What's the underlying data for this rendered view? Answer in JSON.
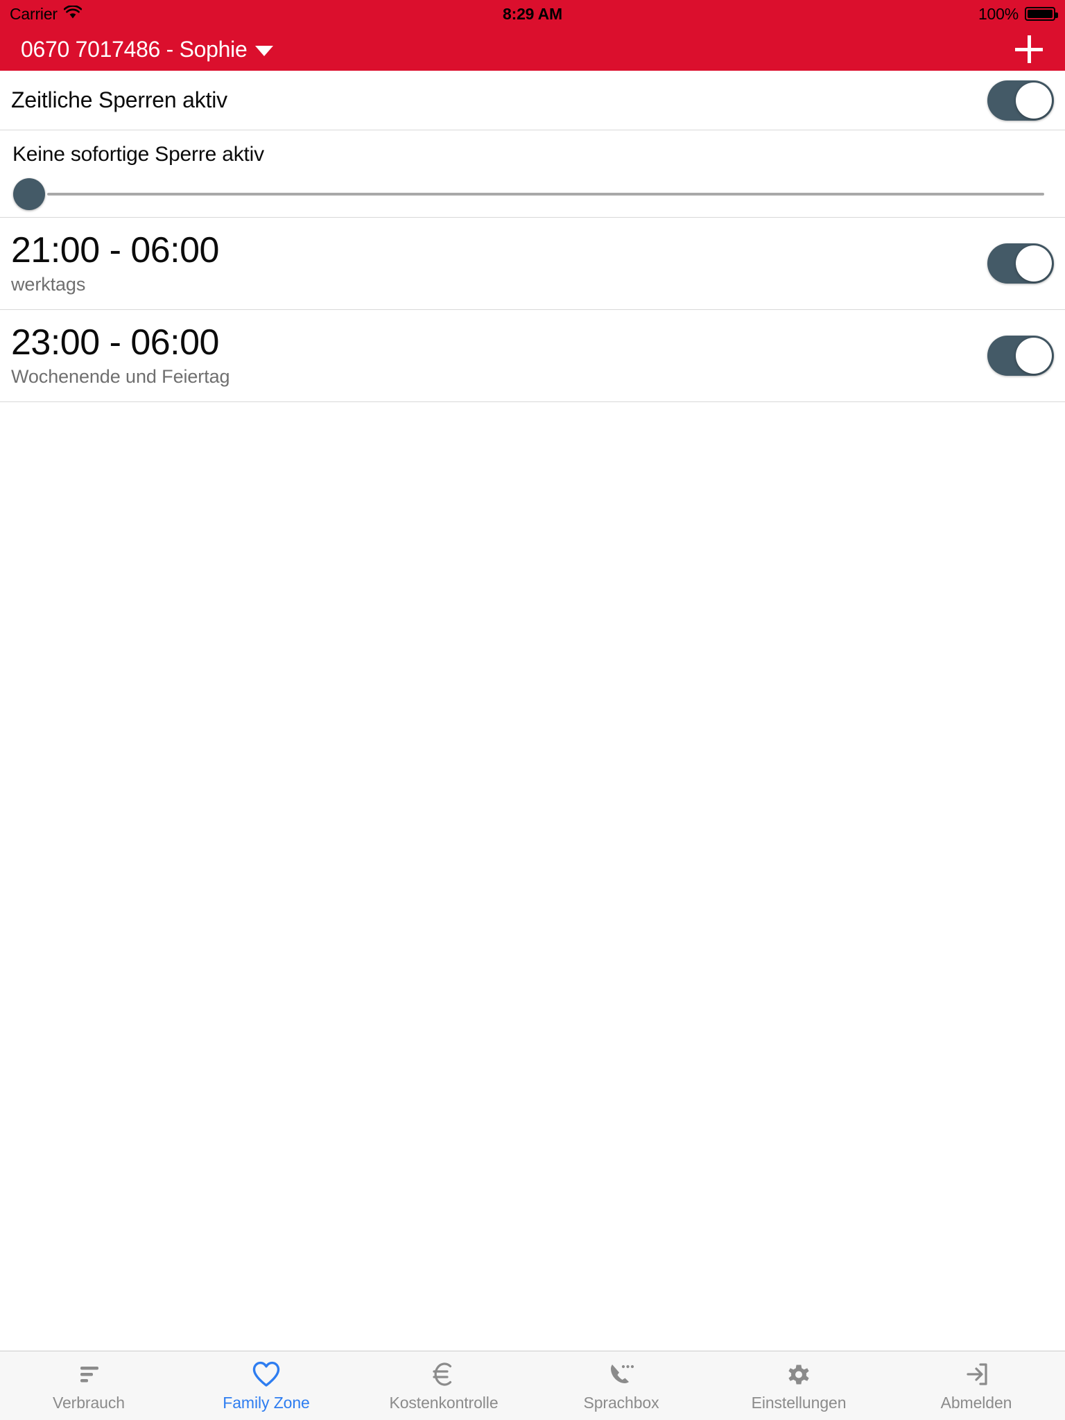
{
  "status_bar": {
    "carrier": "Carrier",
    "wifi_icon": "wifi-icon",
    "time": "8:29 AM",
    "battery_percent": "100%",
    "battery_level": 100
  },
  "header": {
    "title": "0670 7017486 - Sophie",
    "dropdown_icon": "chevron-down-icon",
    "add_icon": "plus-icon",
    "background_color": "#db0f2d"
  },
  "colors": {
    "brand_red": "#db0f2d",
    "toggle_on": "#445a67",
    "slider_track": "#a8a8a8",
    "active_tab": "#2e7df0",
    "inactive_tab": "#8b8b8b"
  },
  "main": {
    "master_toggle": {
      "label": "Zeitliche Sperren aktiv",
      "state": "on"
    },
    "instant_block": {
      "label": "Keine sofortige Sperre aktiv",
      "slider_value": 0,
      "slider_min": 0,
      "slider_max": 100
    },
    "schedules": [
      {
        "time_range": "21:00 - 06:00",
        "days": "werktags",
        "state": "on"
      },
      {
        "time_range": "23:00 - 06:00",
        "days": "Wochenende und Feiertag",
        "state": "on"
      }
    ]
  },
  "tabbar": {
    "active_index": 1,
    "items": [
      {
        "label": "Verbrauch",
        "icon": "bar-chart-icon"
      },
      {
        "label": "Family Zone",
        "icon": "heart-icon"
      },
      {
        "label": "Kostenkontrolle",
        "icon": "euro-icon"
      },
      {
        "label": "Sprachbox",
        "icon": "voicemail-phone-icon"
      },
      {
        "label": "Einstellungen",
        "icon": "gear-icon"
      },
      {
        "label": "Abmelden",
        "icon": "logout-icon"
      }
    ]
  }
}
